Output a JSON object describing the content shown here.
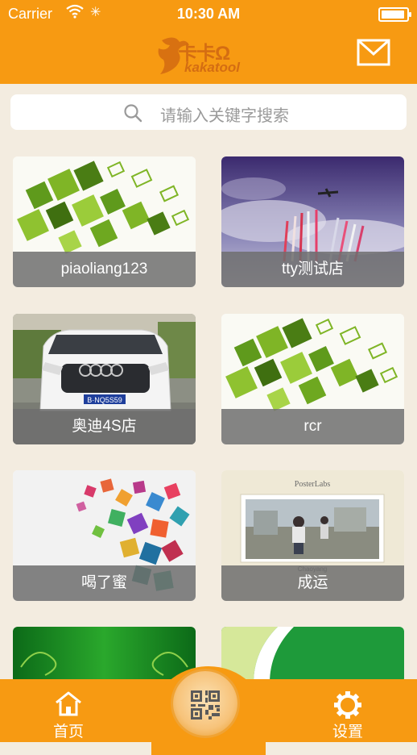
{
  "status_bar": {
    "carrier": "Carrier",
    "time": "10:30 AM"
  },
  "header": {
    "logo_cn": "卡卡Ω",
    "logo_en": "kakatool"
  },
  "search": {
    "placeholder": "请输入关键字搜索"
  },
  "stores": [
    {
      "name": "piaoliang123"
    },
    {
      "name": "tty测试店"
    },
    {
      "name": "奥迪4S店"
    },
    {
      "name": "rcr"
    },
    {
      "name": "喝了蜜"
    },
    {
      "name": "成运"
    }
  ],
  "tabs": {
    "home": "首页",
    "settings": "设置"
  },
  "colors": {
    "brand": "#f79a12",
    "background": "#f3ece0",
    "caption_bg": "#6e6e6e"
  },
  "icons": {
    "header_right": "mail-icon",
    "search": "search-icon",
    "tab_home": "home-icon",
    "tab_center": "qr-code-icon",
    "tab_settings": "gear-icon"
  }
}
